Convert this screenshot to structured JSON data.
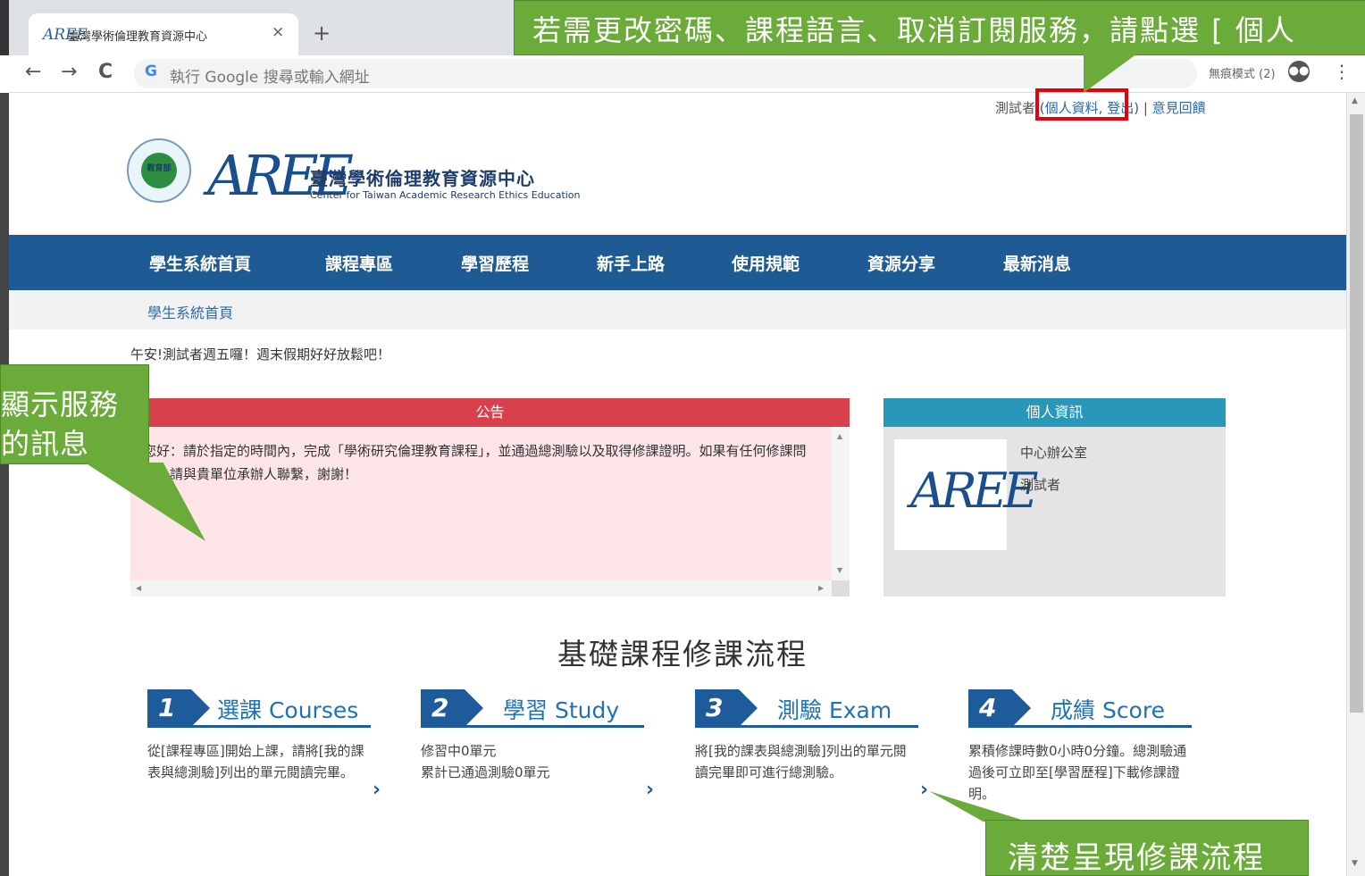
{
  "browser": {
    "tab_title": "臺灣學術倫理教育資源中心",
    "tab_favicon": "AREE",
    "tab_close": "×",
    "new_tab": "+",
    "back": "←",
    "forward": "→",
    "reload": "C",
    "omnibox_placeholder": "執行 Google 搜尋或輸入網址",
    "incognito_label": "無痕模式 (2)",
    "menu": "⋮"
  },
  "userbar": {
    "user": "測試者",
    "open_paren": " (",
    "profile_link": "個人資料",
    "comma": ", ",
    "logout_link": "登出",
    "close_paren": ") | ",
    "feedback_link": "意見回饋"
  },
  "header": {
    "seal_text": "教育部",
    "logo_text": "AREE",
    "title_cn": "臺灣學術倫理教育資源中心",
    "title_en": "Center for Taiwan Academic Research Ethics Education"
  },
  "nav": {
    "items": [
      "學生系統首頁",
      "課程專區",
      "學習歷程",
      "新手上路",
      "使用規範",
      "資源分享",
      "最新消息"
    ]
  },
  "breadcrumb": "學生系統首頁",
  "greeting": "午安!測試者週五囉！週末假期好好放鬆吧！",
  "announcement": {
    "title": "公告",
    "body": "您好：請於指定的時間內，完成「學術研究倫理教育課程」，並通過總測驗以及取得修課證明。如果有任何修課問題，請與貴單位承辦人聯繫，謝謝！"
  },
  "profile": {
    "title": "個人資訊",
    "logo_text": "AREE",
    "unit": "中心辦公室",
    "name": "測試者"
  },
  "steps": {
    "title": "基礎課程修課流程",
    "items": [
      {
        "num": "1",
        "title": "選課 Courses",
        "desc": "從[課程專區]開始上課，請將[我的課表與總測驗]列出的單元閱讀完畢。"
      },
      {
        "num": "2",
        "title": "學習 Study",
        "desc": "修習中0單元\n累計已通過測驗0單元"
      },
      {
        "num": "3",
        "title": "測驗 Exam",
        "desc": "將[我的課表與總測驗]列出的單元閱讀完畢即可進行總測驗。"
      },
      {
        "num": "4",
        "title": "成績 Score",
        "desc": "累積修課時數0小時0分鐘。總測驗通過後可立即至[學習歷程]下載修課證明。"
      }
    ],
    "arrow": "›"
  },
  "callouts": {
    "top": "若需更改密碼、課程語言、取消訂閱服務，請點選 [ 個人",
    "left_line1": "顯示服務",
    "left_line2": "的訊息",
    "bottom": "清楚呈現修課流程"
  },
  "colors": {
    "nav_bg": "#1e5a93",
    "announcement_header": "#d9404c",
    "profile_header": "#2897b8",
    "callout_green": "#6aab3a",
    "highlight_red": "#e8000b"
  }
}
